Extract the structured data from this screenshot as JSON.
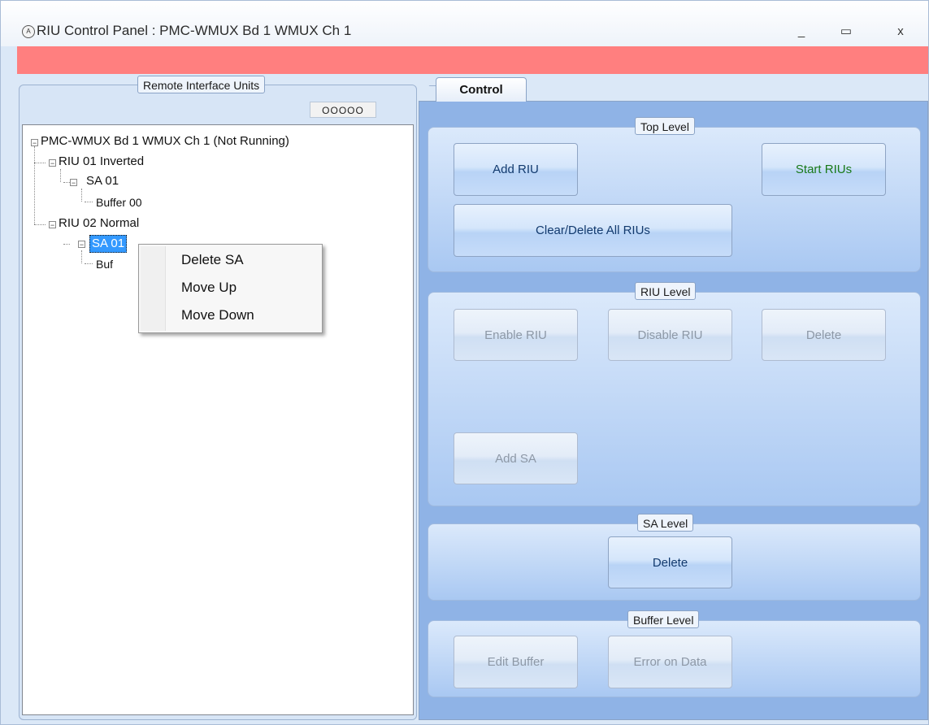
{
  "window": {
    "title": "RIU Control Panel : PMC-WMUX Bd 1 WMUX Ch 1",
    "icon": "A",
    "controls": {
      "minimize": "_",
      "maximize": "▭",
      "close": "x"
    }
  },
  "left_panel": {
    "group_title": "Remote Interface Units",
    "indicator": "OOOOO",
    "tree": {
      "root": "PMC-WMUX Bd 1 WMUX Ch 1 (Not Running)",
      "riu1": "RIU 01 Inverted",
      "riu1_sa": "SA 01",
      "riu1_buffer": "Buffer 00",
      "riu2": "RIU 02 Normal",
      "riu2_sa": "SA 01",
      "riu2_buffer_partial": "Buf"
    }
  },
  "context_menu": {
    "items": [
      "Delete SA",
      "Move Up",
      "Move Down"
    ]
  },
  "tabs": {
    "active": "Control"
  },
  "top_level": {
    "title": "Top Level",
    "add_riu": "Add RIU",
    "start_rius": "Start RIUs",
    "clear_delete_all": "Clear/Delete All RIUs"
  },
  "riu_level": {
    "title": "RIU Level",
    "enable_riu": "Enable RIU",
    "disable_riu": "Disable RIU",
    "delete": "Delete",
    "add_sa": "Add SA"
  },
  "sa_level": {
    "title": "SA Level",
    "delete": "Delete"
  },
  "buffer_level": {
    "title": "Buffer Level",
    "edit_buffer": "Edit Buffer",
    "error_on_data": "Error on Data"
  },
  "colors": {
    "status_bar": "#ff7f7f",
    "selection": "#3399ff",
    "start_text": "#197a19"
  }
}
